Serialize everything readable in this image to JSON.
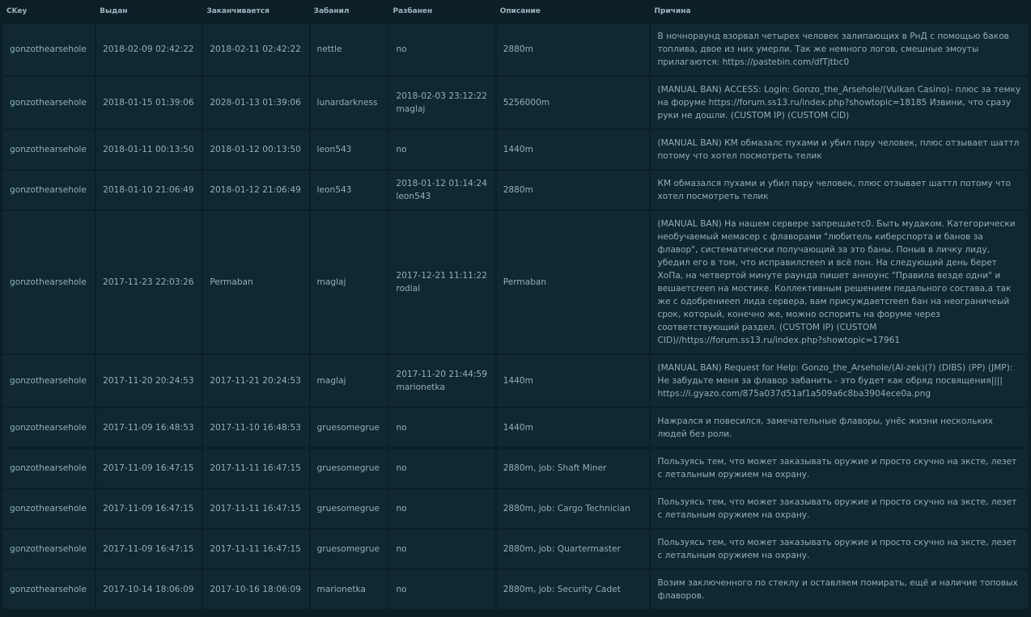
{
  "columns": {
    "ckey": "CKey",
    "issued": "Выдан",
    "expires": "Заканчивается",
    "banned_by": "Забанил",
    "unbanned": "Разбанен",
    "description": "Описание",
    "reason": "Причина"
  },
  "rows": [
    {
      "ckey": "gonzothearsehole",
      "issued": "2018-02-09 02:42:22",
      "expires": "2018-02-11 02:42:22",
      "banned_by": "nettle",
      "unbanned_date": "no",
      "unbanned_by": "",
      "description": "2880m",
      "reason": "В ночнораунд взорвал четырех человек залипающих в РнД с помощью баков топлива, двое из них умерли. Так же немного логов, смешные эмоуты прилагаются: https://pastebin.com/dfTjtbc0"
    },
    {
      "ckey": "gonzothearsehole",
      "issued": "2018-01-15 01:39:06",
      "expires": "2028-01-13 01:39:06",
      "banned_by": "lunardarkness",
      "unbanned_date": "2018-02-03 23:12:22",
      "unbanned_by": "maglaj",
      "description": "5256000m",
      "reason": "(MANUAL BAN) ACCESS: Login: Gonzo_the_Arsehole/(Vulkan Casino)- плюс за темку на форуме https://forum.ss13.ru/index.php?showtopic=18185 Извини, что сразу руки не дошли. (CUSTOM IP) (CUSTOM CID)"
    },
    {
      "ckey": "gonzothearsehole",
      "issued": "2018-01-11 00:13:50",
      "expires": "2018-01-12 00:13:50",
      "banned_by": "leon543",
      "unbanned_date": "no",
      "unbanned_by": "",
      "description": "1440m",
      "reason": "(MANUAL BAN) КМ обмазалс пухами и убил пару человек, плюс отзывает шаттл потому что хотел посмотреть телик"
    },
    {
      "ckey": "gonzothearsehole",
      "issued": "2018-01-10 21:06:49",
      "expires": "2018-01-12 21:06:49",
      "banned_by": "leon543",
      "unbanned_date": "2018-01-12 01:14:24",
      "unbanned_by": "leon543",
      "description": "2880m",
      "reason": "КМ обмазался пухами и убил пару человек, плюс отзывает шаттл потому что хотел посмотреть телик"
    },
    {
      "ckey": "gonzothearsehole",
      "issued": "2017-11-23 22:03:26",
      "expires": "Permaban",
      "banned_by": "maglaj",
      "unbanned_date": "2017-12-21 11:11:22",
      "unbanned_by": "rodial",
      "description": "Permaban",
      "reason": "(MANUAL BAN) На нашем сервере запрещаетс0. Быть мудаком. Категорически необучаемый мемасер с флаворами \"любитель киберспорта и банов за флавор\", систематически получающий за это баны. Поныв в личку лиду, убедил его в том, что исправилcreen и всё пон. На следующий день берет ХоПа, на четвертой минуте раунда пишет анноунс \"Правила везде одни\" и вешаетcreen на мостике. Коллективным решением педального состава,а так же с одобрениеen лида сервера, вам присуждаетcreen бан на неограничеый срок, который, конечно же, можно оспорить на форуме через соответствующий раздел. (CUSTOM IP) (CUSTOM CID)//https://forum.ss13.ru/index.php?showtopic=17961"
    },
    {
      "ckey": "gonzothearsehole",
      "issued": "2017-11-20 20:24:53",
      "expires": "2017-11-21 20:24:53",
      "banned_by": "maglaj",
      "unbanned_date": "2017-11-20 21:44:59",
      "unbanned_by": "marionetka",
      "description": "1440m",
      "reason": "(MANUAL BAN) Request for Help: Gonzo_the_Arsehole/(AI-zek)(?) (DIBS) (PP) (JMP): Не забудьте меня за флавор забанить - это будет как обряд посвящения|||| https://i.gyazo.com/875a037d51af1a509a6c8ba3904ece0a.png"
    },
    {
      "ckey": "gonzothearsehole",
      "issued": "2017-11-09 16:48:53",
      "expires": "2017-11-10 16:48:53",
      "banned_by": "gruesomegrue",
      "unbanned_date": "no",
      "unbanned_by": "",
      "description": "1440m",
      "reason": "Нажрался и повесился, замечательные флаворы, унёс жизни нескольких людей без роли."
    },
    {
      "ckey": "gonzothearsehole",
      "issued": "2017-11-09 16:47:15",
      "expires": "2017-11-11 16:47:15",
      "banned_by": "gruesomegrue",
      "unbanned_date": "no",
      "unbanned_by": "",
      "description": "2880m, job: Shaft Miner",
      "reason": "Пользуясь тем, что может заказывать оружие и просто скучно на эксте, лезет с летальным оружием на охрану."
    },
    {
      "ckey": "gonzothearsehole",
      "issued": "2017-11-09 16:47:15",
      "expires": "2017-11-11 16:47:15",
      "banned_by": "gruesomegrue",
      "unbanned_date": "no",
      "unbanned_by": "",
      "description": "2880m, job: Cargo Technician",
      "reason": "Пользуясь тем, что может заказывать оружие и просто скучно на эксте, лезет с летальным оружием на охрану."
    },
    {
      "ckey": "gonzothearsehole",
      "issued": "2017-11-09 16:47:15",
      "expires": "2017-11-11 16:47:15",
      "banned_by": "gruesomegrue",
      "unbanned_date": "no",
      "unbanned_by": "",
      "description": "2880m, job: Quartermaster",
      "reason": "Пользуясь тем, что может заказывать оружие и просто скучно на эксте, лезет с летальным оружием на охрану."
    },
    {
      "ckey": "gonzothearsehole",
      "issued": "2017-10-14 18:06:09",
      "expires": "2017-10-16 18:06:09",
      "banned_by": "marionetka",
      "unbanned_date": "no",
      "unbanned_by": "",
      "description": "2880m, job: Security Cadet",
      "reason": "Возим заключенного по стеклу и оставляем помирать, ещё и наличие топовых флаворов."
    }
  ]
}
